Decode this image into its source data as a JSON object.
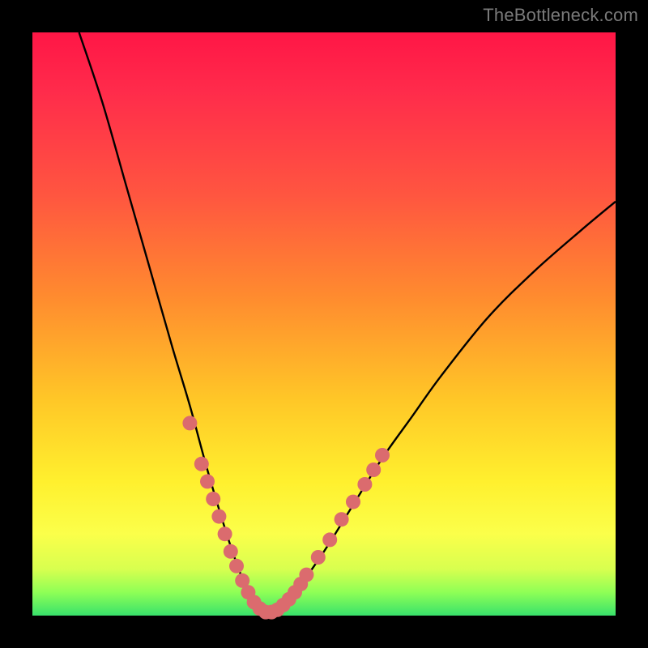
{
  "watermark": "TheBottleneck.com",
  "chart_data": {
    "type": "line",
    "title": "",
    "xlabel": "",
    "ylabel": "",
    "xlim": [
      0,
      100
    ],
    "ylim": [
      0,
      100
    ],
    "grid": false,
    "legend": false,
    "series": [
      {
        "name": "bottleneck-curve",
        "color": "#000000",
        "x": [
          8,
          12,
          16,
          20,
          24,
          27,
          30,
          33,
          35,
          37,
          39,
          40,
          42,
          45,
          50,
          55,
          60,
          65,
          70,
          78,
          86,
          94,
          100
        ],
        "y": [
          100,
          88,
          74,
          60,
          46,
          36,
          25,
          15,
          9,
          4,
          1,
          0,
          1,
          4,
          11,
          19,
          27,
          34,
          41,
          51,
          59,
          66,
          71
        ]
      }
    ],
    "markers": [
      {
        "name": "highlight-dots",
        "color": "#db6b6e",
        "radius_px": 9,
        "points": [
          {
            "x": 27.0,
            "y": 33
          },
          {
            "x": 29.0,
            "y": 26
          },
          {
            "x": 30.0,
            "y": 23
          },
          {
            "x": 31.0,
            "y": 20
          },
          {
            "x": 32.0,
            "y": 17
          },
          {
            "x": 33.0,
            "y": 14
          },
          {
            "x": 34.0,
            "y": 11
          },
          {
            "x": 35.0,
            "y": 8.5
          },
          {
            "x": 36.0,
            "y": 6
          },
          {
            "x": 37.0,
            "y": 4
          },
          {
            "x": 38.0,
            "y": 2.3
          },
          {
            "x": 39.0,
            "y": 1.2
          },
          {
            "x": 40.0,
            "y": 0.6
          },
          {
            "x": 41.0,
            "y": 0.6
          },
          {
            "x": 42.0,
            "y": 1.0
          },
          {
            "x": 43.0,
            "y": 1.8
          },
          {
            "x": 44.0,
            "y": 2.8
          },
          {
            "x": 45.0,
            "y": 4.0
          },
          {
            "x": 46.0,
            "y": 5.4
          },
          {
            "x": 47.0,
            "y": 7.0
          },
          {
            "x": 49.0,
            "y": 10
          },
          {
            "x": 51.0,
            "y": 13
          },
          {
            "x": 53.0,
            "y": 16.5
          },
          {
            "x": 55.0,
            "y": 19.5
          },
          {
            "x": 57.0,
            "y": 22.5
          },
          {
            "x": 58.5,
            "y": 25
          },
          {
            "x": 60.0,
            "y": 27.5
          }
        ]
      }
    ]
  }
}
